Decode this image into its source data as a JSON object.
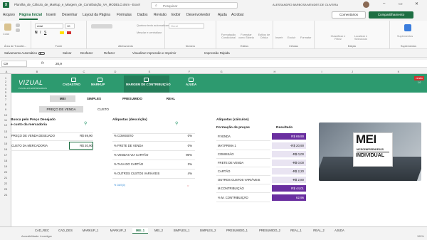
{
  "titlebar": {
    "filename": "Planilha_de_Cálculo_de_Markup_e_Margem_de_Contribuição_VA_MODELO.xlsm - Excel",
    "search_placeholder": "Pesquisar",
    "user": "ALESSANDRO BARBOSA MENDES DE OLIVEIRA",
    "logo_letter": "X",
    "search_icon": "⌕",
    "minimize": "–",
    "maximize": "▭",
    "close": "✕"
  },
  "menu": {
    "items": [
      "Arquivo",
      "Página Inicial",
      "Inserir",
      "Desenhar",
      "Layout da Página",
      "Fórmulas",
      "Dados",
      "Revisão",
      "Exibir",
      "Desenvolvedor",
      "Ajuda",
      "Acrobat"
    ],
    "comments": "Comentários",
    "share": "Compartilhamento"
  },
  "ribbon": {
    "groups": [
      "Área de Transfer...",
      "Fonte",
      "Alinhamento",
      "Número",
      "Estilos",
      "Células",
      "Edição",
      "Suplementos"
    ],
    "font_name": "Arial",
    "font_size": "10",
    "paste": "Colar",
    "wrap": "Quebrar texto automaticamente",
    "merge": "Mesclar e centralizar",
    "number_format": "Geral",
    "cond_format": "Formatação Condicional",
    "format_table": "Formatar como Tabela",
    "cell_styles": "Estilos de Célula",
    "insert": "Inserir",
    "delete": "Excluir",
    "format": "Formatar",
    "sort": "Classificar e Filtrar",
    "find": "Localizar e Selecionar",
    "addins": "Suplementos"
  },
  "qat": {
    "autosave": "Salvamento Automático",
    "save": "Salvar",
    "undo": "Desfazer",
    "redo": "Refazer",
    "preview": "Visualizar Impressão e Imprimir",
    "quick_print": "Impressão Rápida"
  },
  "formula_bar": {
    "cell": "C9",
    "fx": "fx",
    "value": "20,9"
  },
  "columns": [
    "A",
    "B",
    "C",
    "D",
    "E",
    "F",
    "G",
    "H",
    "I",
    "J",
    "K"
  ],
  "rows": [
    "1",
    "2",
    "3",
    "4",
    "5",
    "6",
    "7",
    "8",
    "9",
    "10",
    "11",
    "12",
    "13",
    "14",
    "15",
    "16",
    "17",
    "18",
    "19",
    "20",
    "21",
    "22",
    "23",
    "24"
  ],
  "appbar": {
    "logo": "VIZUAL",
    "logo_sub": "PLANILHAS EMPRESARIAIS",
    "nav": [
      "CADASTRO",
      "MARKUP",
      "MARGEM DE CONTRIBUIÇÃO",
      "AJUDA"
    ],
    "version": "versão 1.0"
  },
  "subtabs": [
    "MEI",
    "SIMPLES",
    "PRESUMIDO",
    "REAL"
  ],
  "subtabs2": [
    "PREÇO DE VENDA",
    "CUSTO"
  ],
  "left": {
    "title_line1": "Busca pelo Preço Desejado",
    "title_line2": "e custo da mercadoria",
    "rows": [
      {
        "label": "PREÇO DE VENDA DESEJADO",
        "value": "R$ 69,90"
      },
      {
        "label": "CUSTO DA MERCADORIA",
        "value": "R$ 20,90"
      }
    ]
  },
  "aliquotas": {
    "title": "Alíquotas (descrição)",
    "rows": [
      {
        "label": "% COMISSÃO",
        "value": "0%"
      },
      {
        "label": "% FRETE DE VENDA",
        "value": "0%"
      },
      {
        "label": "% VENDAS VIA CARTÃO",
        "value": "90%"
      },
      {
        "label": "% TAXA DO CARTÃO",
        "value": "3%"
      },
      {
        "label": "% OUTROS CUSTOS VARIÁVEIS",
        "value": "4%"
      }
    ],
    "link": "% DAS(0)",
    "pin": "⚲"
  },
  "calc": {
    "title": "Alíquotas (cálculos)",
    "subtitle": "Formação de preços",
    "result_header": "Resultado",
    "rows": [
      {
        "label": "P.VENDA",
        "value": "R$ 69,90",
        "style": "purple"
      },
      {
        "label": "MAT.PRIMA 1",
        "value": "-R$ 20,90",
        "style": "lav"
      },
      {
        "label": "COMISSÃO",
        "value": "-R$ 0,00",
        "style": "lav"
      },
      {
        "label": "FRETE DE VENDA",
        "value": "-R$ 0,00",
        "style": "lav"
      },
      {
        "label": "CARTÃO",
        "value": "-R$ 2,20",
        "style": "lav"
      },
      {
        "label": "OUTROS CUSTOS VARIÁVEIS",
        "value": "-R$ 2,80",
        "style": "lav"
      },
      {
        "label": "M.CONTRIBUIÇÃO",
        "value": "R$ 44,01",
        "style": "purple"
      },
      {
        "label": "% M. CONTRIBUIÇÃO",
        "value": "62,96",
        "style": "purple"
      }
    ]
  },
  "promo": {
    "title": "MEI",
    "small": "MICROEMPREENDEDOR",
    "sub": "INDIVIDUAL"
  },
  "sheet_tabs": [
    "CAD_REC",
    "CAD_DES",
    "MARKUP_1",
    "MARKUP_2",
    "MEI_1",
    "MEI_2",
    "SIMPLES_1",
    "SIMPLES_2",
    "PRESUMIDO_1",
    "PRESUMIDO_2",
    "REAL_1",
    "REAL_2",
    "AJUDA"
  ],
  "active_sheet": "MEI_1",
  "status": {
    "left": "Acessibilidade: Investigar",
    "zoom": "100%"
  }
}
